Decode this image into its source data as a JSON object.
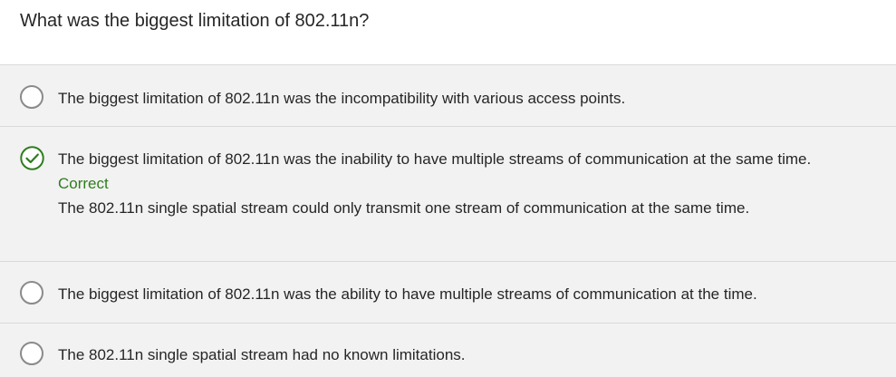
{
  "question": {
    "text": "What was the biggest limitation of 802.11n?"
  },
  "options": [
    {
      "text": "The biggest limitation of 802.11n was the incompatibility with various access points.",
      "selected": false
    },
    {
      "text": "The biggest limitation of 802.11n was the inability to have multiple streams of communication at the same time.",
      "selected": true,
      "feedback_title": "Correct",
      "feedback_text": "The 802.11n single spatial stream could only transmit one stream of communication at the same time."
    },
    {
      "text": "The biggest limitation of 802.11n was the ability to have multiple streams of communication at the time.",
      "selected": false
    },
    {
      "text": "The 802.11n single spatial stream had no known limitations.",
      "selected": false
    }
  ],
  "colors": {
    "correct": "#2f7d1f",
    "option_bg": "#f2f2f2",
    "divider": "#d9d9d9"
  },
  "icons": {
    "correct": "check-circle-icon",
    "unselected": "radio-unchecked-icon"
  }
}
